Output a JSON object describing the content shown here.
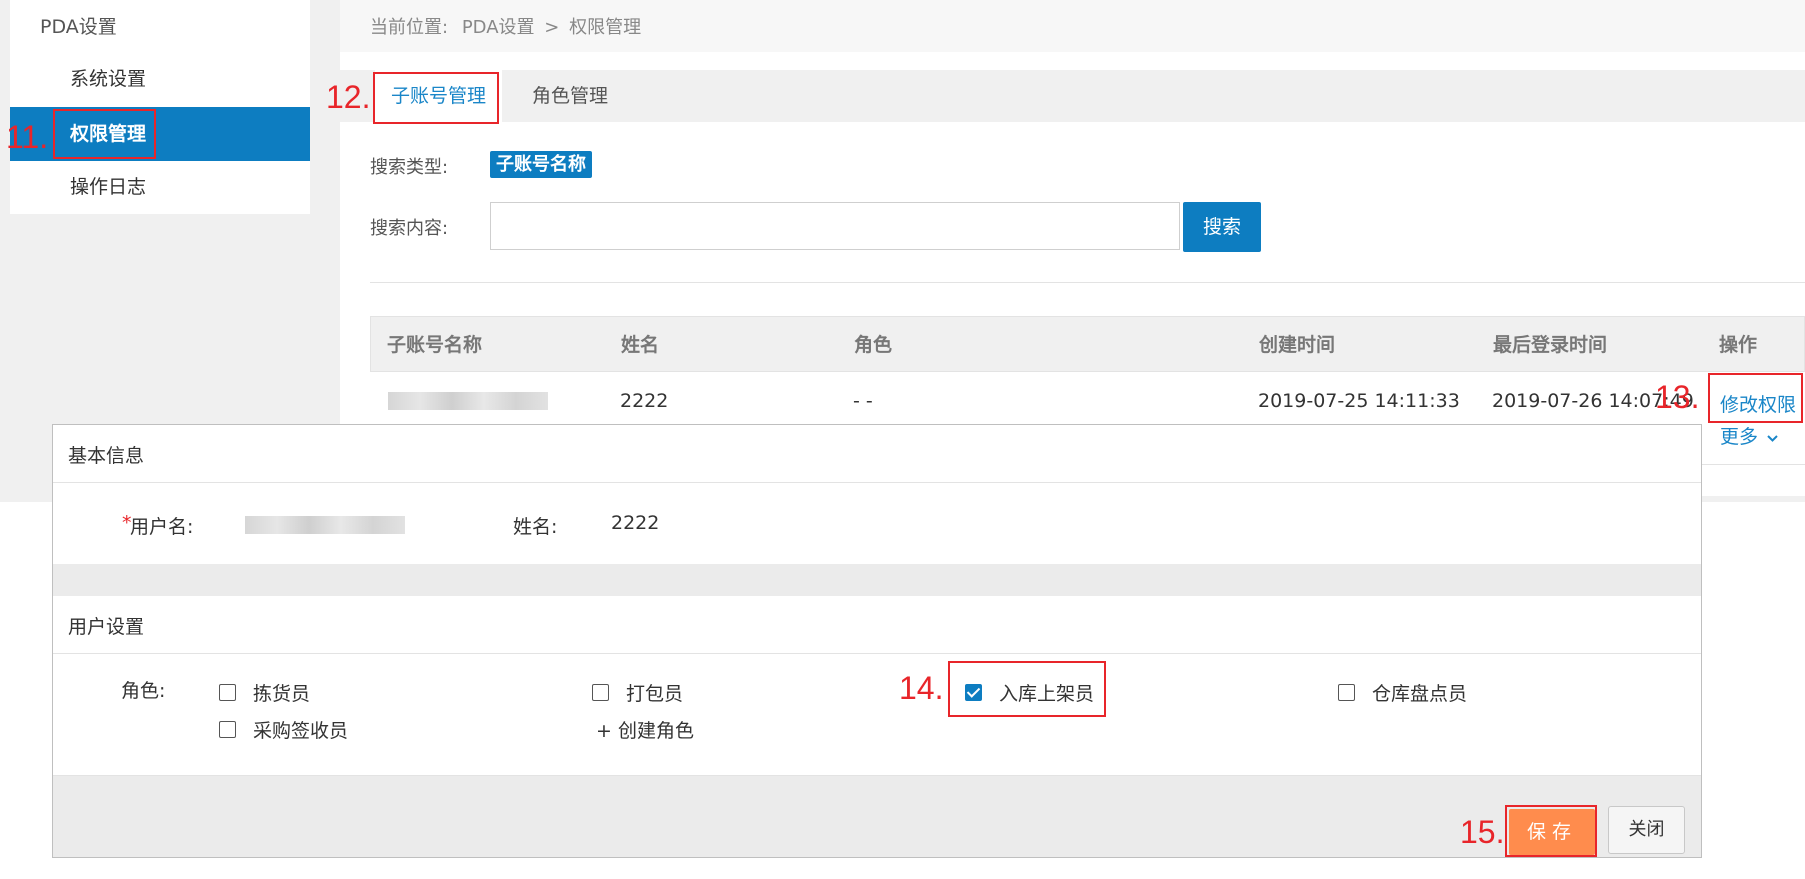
{
  "sidebar": {
    "header": "PDA设置",
    "items": [
      {
        "label": "系统设置"
      },
      {
        "label": "权限管理"
      },
      {
        "label": "操作日志"
      }
    ]
  },
  "breadcrumb": {
    "prefix": "当前位置:",
    "root": "PDA设置",
    "separator": ">",
    "current": "权限管理"
  },
  "tabs": [
    {
      "label": "子账号管理"
    },
    {
      "label": "角色管理"
    }
  ],
  "search": {
    "type_label": "搜索类型:",
    "type_value": "子账号名称",
    "content_label": "搜索内容:",
    "content_value": "",
    "button": "搜索"
  },
  "table": {
    "headers": [
      "子账号名称",
      "姓名",
      "角色",
      "创建时间",
      "最后登录时间",
      "操作"
    ],
    "rows": [
      {
        "name": "2222",
        "role": "- -",
        "created": "2019-07-25 14:11:33",
        "last_login": "2019-07-26 14:07:49",
        "action_edit": "修改权限",
        "action_more": "更多"
      }
    ]
  },
  "modal": {
    "basic_title": "基本信息",
    "required_mark": "*",
    "username_label": "用户名:",
    "name_label": "姓名:",
    "name_value": "2222",
    "user_settings_title": "用户设置",
    "role_label": "角色:",
    "roles": [
      {
        "label": "拣货员",
        "checked": false
      },
      {
        "label": "打包员",
        "checked": false
      },
      {
        "label": "入库上架员",
        "checked": true
      },
      {
        "label": "仓库盘点员",
        "checked": false
      },
      {
        "label": "采购签收员",
        "checked": false
      }
    ],
    "create_role": "+ 创建角色",
    "save": "保存",
    "close": "关闭"
  },
  "annotations": [
    "11.",
    "12.",
    "13.",
    "14.",
    "15."
  ],
  "colors": {
    "accent": "#0d7dc1",
    "link": "#1a86c8",
    "save": "#ff8c4d",
    "annotation": "#e8252a"
  }
}
